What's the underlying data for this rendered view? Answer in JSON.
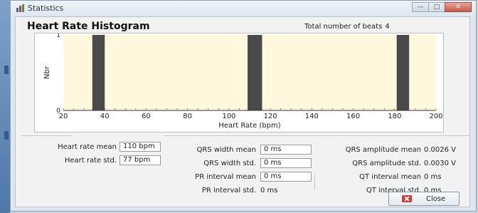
{
  "window": {
    "title": "Statistics",
    "buttons": {
      "minimize": "—",
      "maximize": "□",
      "close": "✕"
    }
  },
  "histogram": {
    "title": "Heart Rate Histogram",
    "total_label": "Total number of beats",
    "total_value": "4"
  },
  "chart_data": {
    "type": "bar",
    "title": "Heart Rate Histogram",
    "xlabel": "Heart Rate (bpm)",
    "ylabel": "Nbr",
    "xlim": [
      20,
      200
    ],
    "ylim": [
      0,
      1
    ],
    "xticks": [
      "20",
      "40",
      "60",
      "80",
      "100",
      "120",
      "140",
      "160",
      "180",
      "200"
    ],
    "yticks": [
      "0",
      "1"
    ],
    "bins": [
      {
        "x": 37,
        "count": 1
      },
      {
        "x": 112,
        "count": 1
      },
      {
        "x": 113,
        "count": 1
      },
      {
        "x": 184,
        "count": 1
      }
    ],
    "colors": {
      "background": "#fff8dc",
      "bar": "#4a4a4a"
    },
    "grid": false,
    "legend": "none"
  },
  "stats": {
    "hr_mean_label": "Heart rate mean",
    "hr_mean_value": "110 bpm",
    "hr_std_label": "Heart rate std.",
    "hr_std_value": "77 bpm",
    "qrs_width_mean_label": "QRS width mean",
    "qrs_width_mean_value": "0 ms",
    "qrs_width_std_label": "QRS width std.",
    "qrs_width_std_value": "0 ms",
    "pr_mean_label": "PR interval mean",
    "pr_mean_value": "0 ms",
    "pr_std_label": "PR interval std.",
    "pr_std_value": "0 ms",
    "qrs_amp_mean_label": "QRS amplitude mean",
    "qrs_amp_mean_value": "0.0026 V",
    "qrs_amp_std_label": "QRS amplitude std.",
    "qrs_amp_std_value": "0.0030 V",
    "qt_mean_label": "QT interval mean",
    "qt_mean_value": "0 ms",
    "qt_std_label": "QT interval std.",
    "qt_std_value": "0 ms"
  },
  "close_button": {
    "label": "Close"
  }
}
